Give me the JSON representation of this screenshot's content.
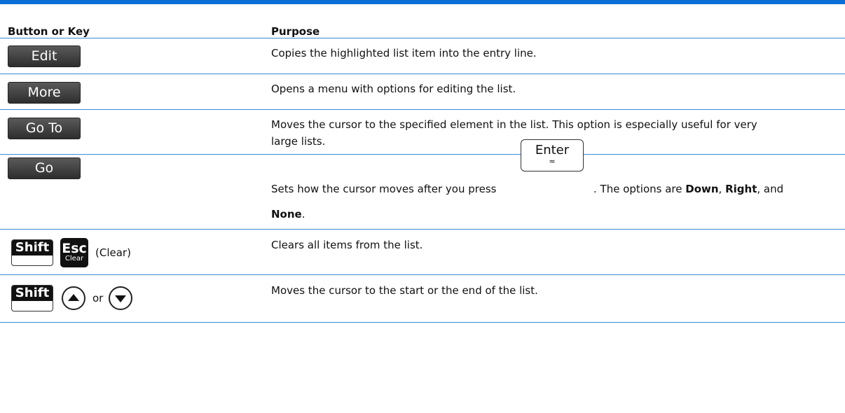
{
  "header": {
    "col1": "Button or Key",
    "col2": "Purpose"
  },
  "rows": [
    {
      "key": "Edit",
      "purpose": "Copies the highlighted list item into the entry line."
    },
    {
      "key": "More",
      "purpose": "Opens a menu with options for editing the list."
    },
    {
      "key": "Go To",
      "purpose": "Moves the cursor to the specified element in the list. This option is especially useful for very",
      "purpose2": "large lists."
    },
    {
      "key": "Go",
      "purpose_pre": "Sets how the cursor moves after you press",
      "enter_main": "Enter",
      "enter_sub": "≈",
      "purpose_mid": ". The options are ",
      "opt_down": "Down",
      "sep1": ", ",
      "opt_right": "Right",
      "sep2": ", and",
      "opt_none": "None",
      "end": "."
    },
    {
      "key_shift": "Shift",
      "key_esc": "Esc",
      "key_esc_sub": "Clear",
      "key_label": "(Clear)",
      "purpose": "Clears all items from the list."
    },
    {
      "key_shift": "Shift",
      "key_or": "or",
      "up_icon": "up-arrow-icon",
      "down_icon": "down-arrow-icon",
      "purpose": "Moves the cursor to the start or the end of the list."
    }
  ],
  "colors": {
    "accent": "#0a6fd4",
    "rule": "#3d8ad8"
  }
}
